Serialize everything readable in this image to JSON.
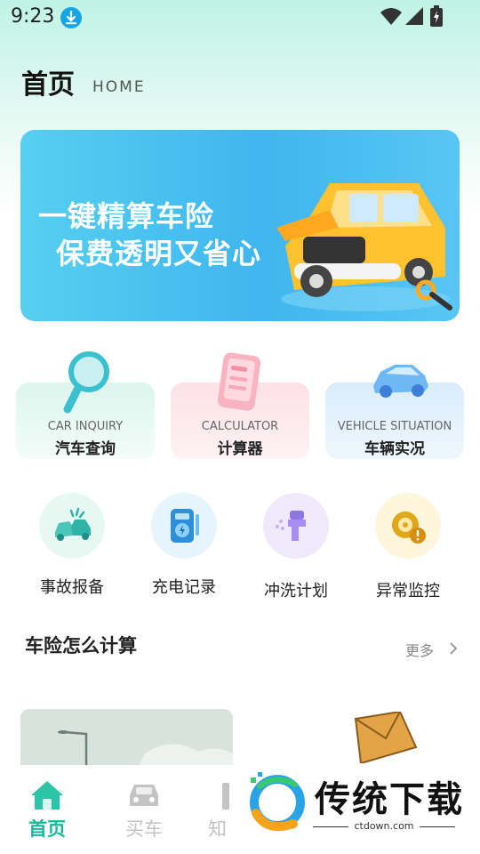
{
  "status_bar": {
    "time": "9:23",
    "icons": [
      "download-icon",
      "wifi-icon",
      "signal-icon",
      "battery-charging-icon"
    ]
  },
  "header": {
    "title": "首页",
    "subtitle": "HOME"
  },
  "banner": {
    "line1": "一键精算车险",
    "line2": "保费透明又省心"
  },
  "feature_cards": [
    {
      "en": "CAR INQUIRY",
      "cn": "汽车查询",
      "icon": "magnifier-icon"
    },
    {
      "en": "CALCULATOR",
      "cn": "计算器",
      "icon": "calculator-icon"
    },
    {
      "en": "VEHICLE SITUATION",
      "cn": "车辆实况",
      "icon": "car-icon"
    }
  ],
  "quick_actions": [
    {
      "label": "事故报备",
      "icon": "car-accident-icon"
    },
    {
      "label": "充电记录",
      "icon": "charging-record-icon"
    },
    {
      "label": "冲洗计划",
      "icon": "wash-spray-icon"
    },
    {
      "label": "异常监控",
      "icon": "alert-monitor-icon"
    }
  ],
  "section": {
    "title": "车险怎么计算",
    "more": "更多"
  },
  "bottom_nav": [
    {
      "label": "首页",
      "icon": "home-icon",
      "active": true
    },
    {
      "label": "买车",
      "icon": "car-icon",
      "active": false
    },
    {
      "label": "知",
      "icon": "book-icon",
      "active": false
    }
  ],
  "watermark": {
    "title": "传统下载",
    "url": "ctdown.com"
  },
  "colors": {
    "accent": "#18b79a",
    "banner": "#3fb6ee",
    "inactive": "#c3c3c3"
  }
}
